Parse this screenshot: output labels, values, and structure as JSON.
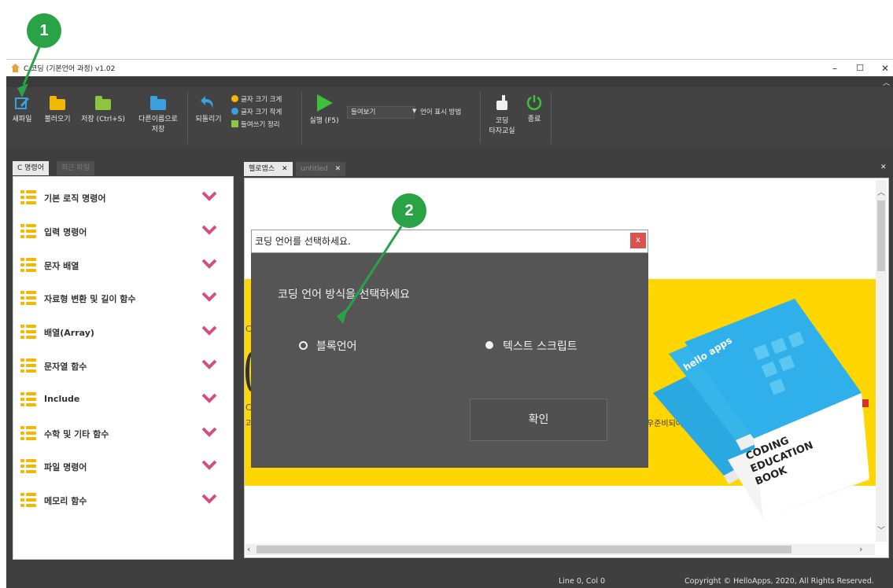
{
  "window": {
    "title": "C 코딩 (기본언어 과정) v1.02",
    "minimize": "–",
    "maximize": "☐",
    "close": "✕"
  },
  "toolbar": {
    "new_file": "새파일",
    "open": "불러오기",
    "save": "저장 (Ctrl+S)",
    "save_as_line1": "다른이름으로",
    "save_as_line2": "저장",
    "undo": "되돌리기",
    "font_bigger": "글자 크기 크게",
    "font_smaller": "글자 크기 작게",
    "indent": "들여쓰기 정리",
    "run": "실행 (F5)",
    "lang_select_value": "들여보기",
    "lang_display": "언어 표시 방법",
    "typing_line1": "코딩",
    "typing_line2": "타자교실",
    "exit": "종료"
  },
  "left_panel": {
    "tabs": [
      "C 명령어",
      "최근 파일"
    ],
    "categories": [
      "기본 로직 명령어",
      "입력 명령어",
      "문자 배열",
      "자료형 변환 및 길이 함수",
      "배열(Array)",
      "문자열 함수",
      "Include",
      "수학 및 기타 함수",
      "파일 명령어",
      "메모리 함수"
    ]
  },
  "editor": {
    "tabs": [
      "헬로앱스",
      "untitled"
    ],
    "tab_close": "✕",
    "pane_close": "✕",
    "behind_text": "우준비되어 있습니다.",
    "book_brand": "hello apps",
    "book_title_1": "CODING",
    "book_title_2": "EDUCATION",
    "book_title_3": "BOOK"
  },
  "dialog": {
    "title": "코딩 언어를 선택하세요.",
    "close": "x",
    "prompt": "코딩 언어 방식을 선택하세요",
    "option_block": "블록언어",
    "option_text": "텍스트 스크립트",
    "selected": "블록언어",
    "ok": "확인"
  },
  "callouts": [
    "1",
    "2"
  ],
  "status": {
    "position": "Line 0, Col 0",
    "copyright": "Copyright © HelloApps, 2020, All Rights Reserved."
  },
  "colors": {
    "accent_green": "#2aa347",
    "yellow": "#ffd600",
    "chevron_pink": "#d4507a",
    "dark_bg": "#3f3f3f"
  }
}
